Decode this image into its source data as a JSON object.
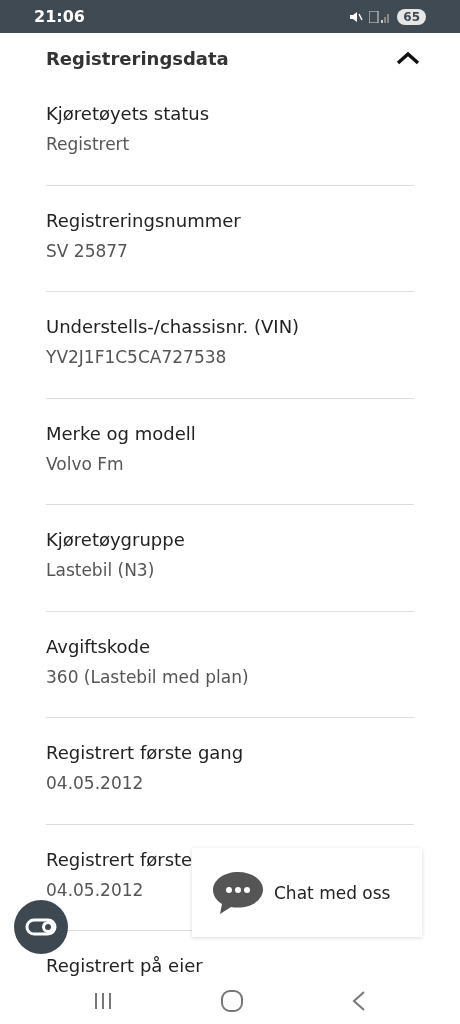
{
  "status_bar": {
    "time": "21:06",
    "battery": "65"
  },
  "section": {
    "title": "Registreringsdata",
    "expanded": true
  },
  "fields": [
    {
      "label": "Kjøretøyets status",
      "value": "Registrert"
    },
    {
      "label": "Registreringsnummer",
      "value": "SV 25877"
    },
    {
      "label": "Understells-/chassisnr. (VIN)",
      "value": "YV2J1F1C5CA727538"
    },
    {
      "label": "Merke og modell",
      "value": "Volvo Fm"
    },
    {
      "label": "Kjøretøygruppe",
      "value": "Lastebil (N3)"
    },
    {
      "label": "Avgiftskode",
      "value": "360 (Lastebil med plan)"
    },
    {
      "label": "Registrert første gang",
      "value": "04.05.2012"
    },
    {
      "label": "Registrert første",
      "value": "04.05.2012"
    },
    {
      "label": "Registrert på eier"
    }
  ],
  "chat": {
    "label": "Chat med oss"
  }
}
